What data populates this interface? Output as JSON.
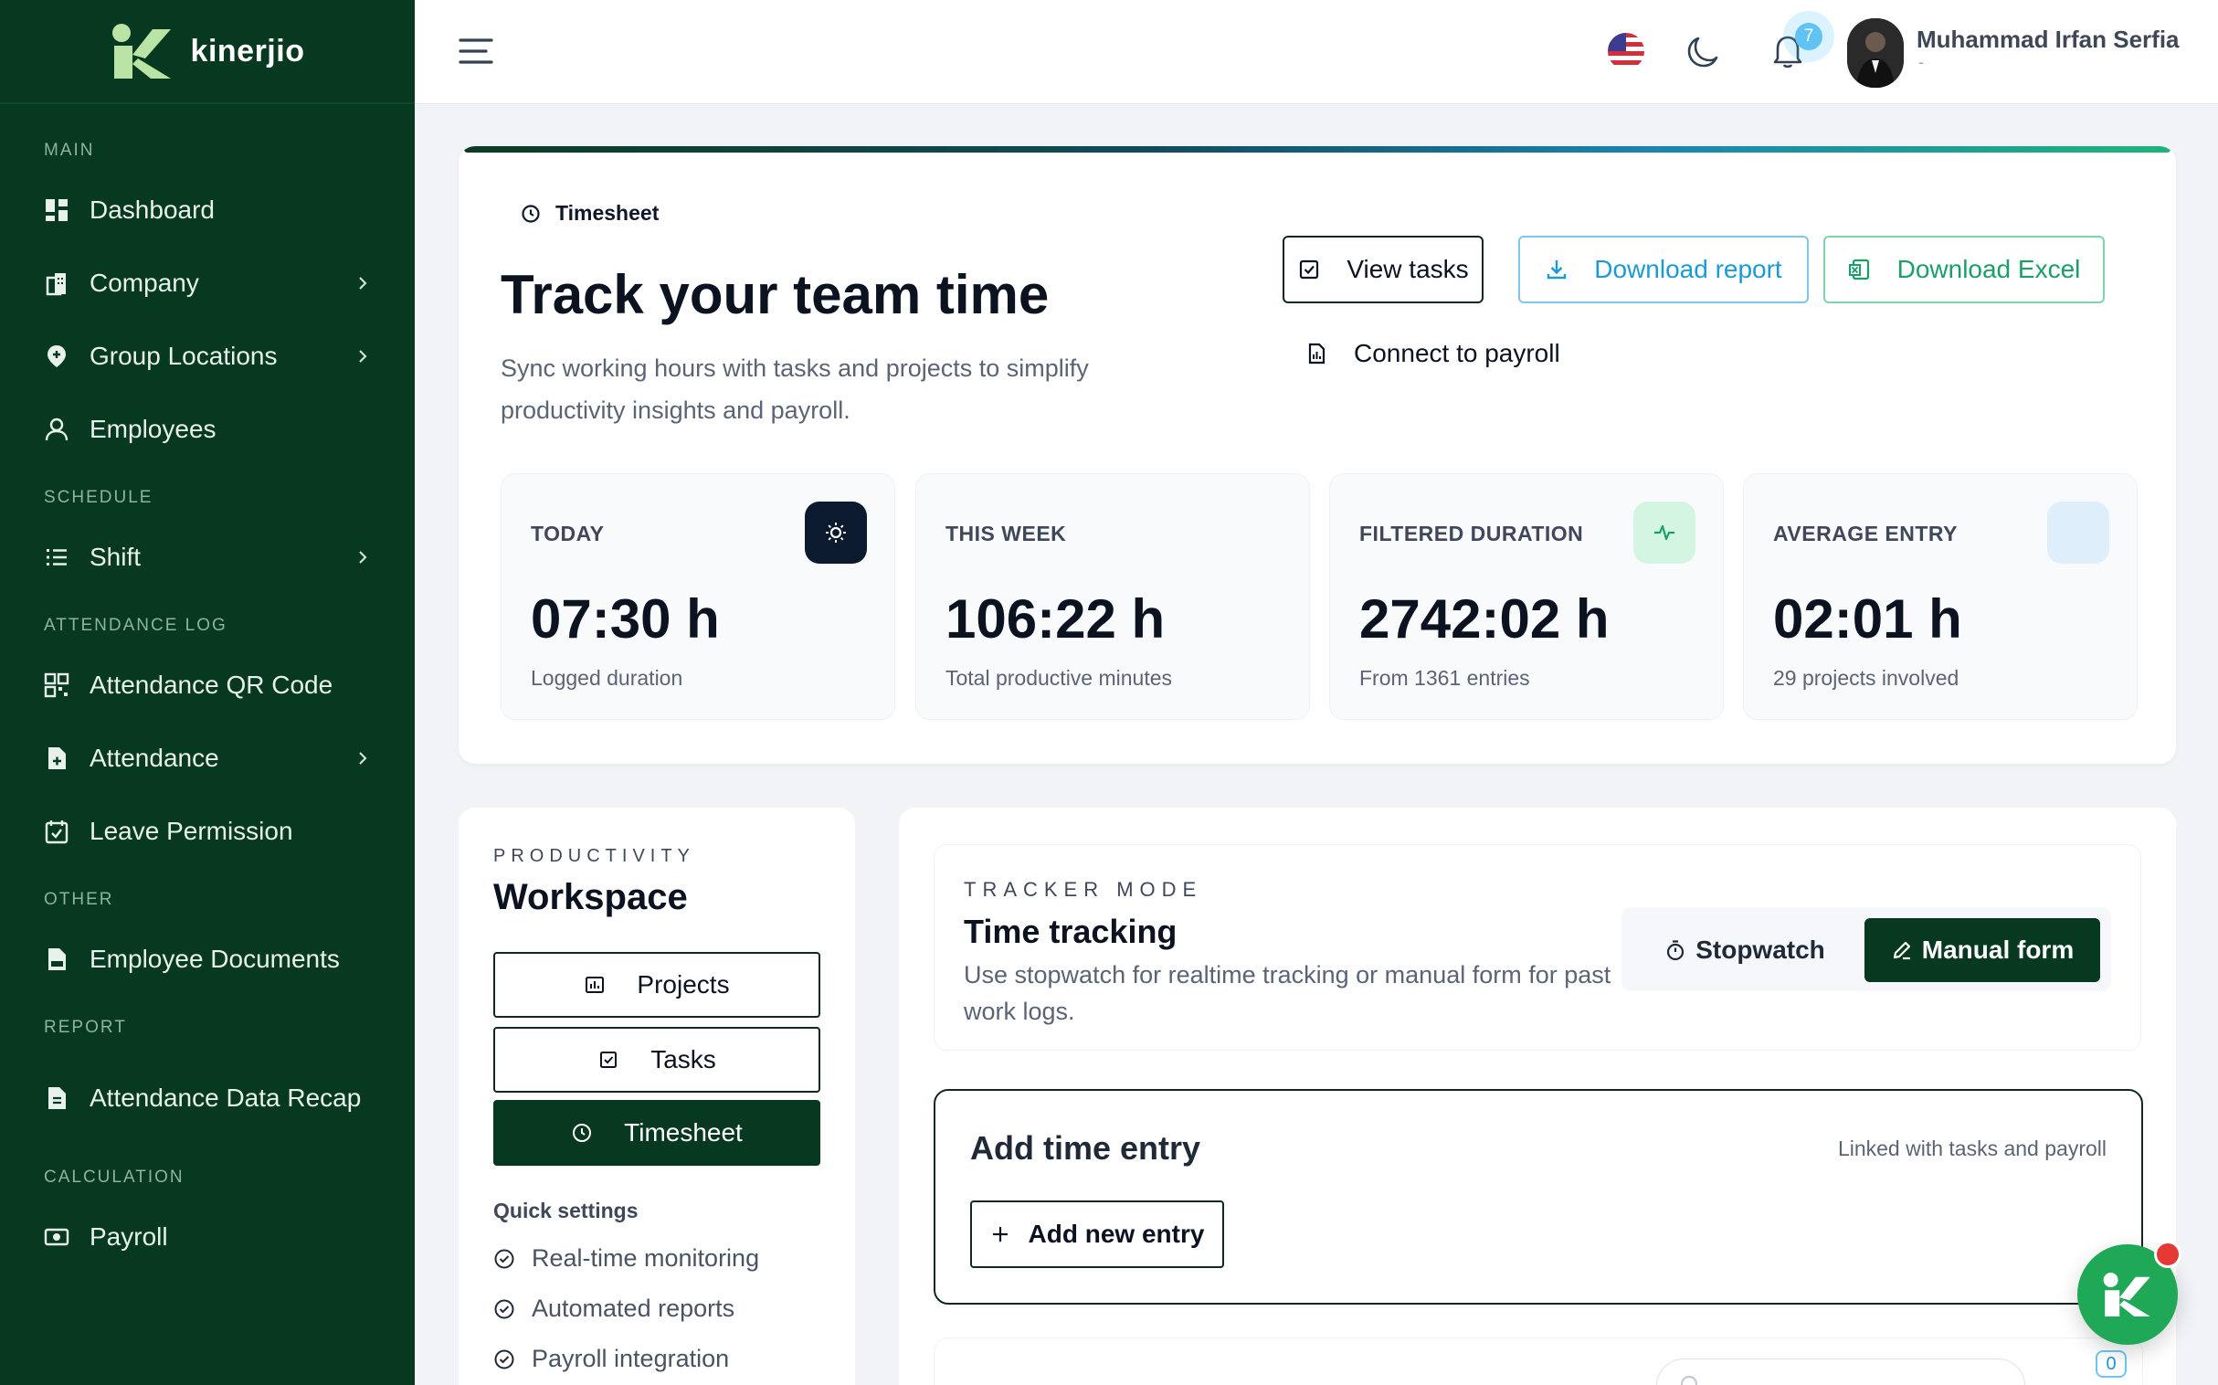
{
  "brand": {
    "name": "kinerjio"
  },
  "sidebar": {
    "sections": [
      {
        "title": "MAIN",
        "items": [
          {
            "label": "Dashboard",
            "icon": "dashboard-icon",
            "chevron": false
          },
          {
            "label": "Company",
            "icon": "building-icon",
            "chevron": true
          },
          {
            "label": "Group Locations",
            "icon": "location-pin-icon",
            "chevron": true
          },
          {
            "label": "Employees",
            "icon": "user-icon",
            "chevron": false
          }
        ]
      },
      {
        "title": "SCHEDULE",
        "items": [
          {
            "label": "Shift",
            "icon": "list-icon",
            "chevron": true
          }
        ]
      },
      {
        "title": "ATTENDANCE LOG",
        "items": [
          {
            "label": "Attendance QR Code",
            "icon": "qr-code-icon",
            "chevron": false
          },
          {
            "label": "Attendance",
            "icon": "file-plus-icon",
            "chevron": true
          },
          {
            "label": "Leave Permission",
            "icon": "calendar-check-icon",
            "chevron": false
          }
        ]
      },
      {
        "title": "OTHER",
        "items": [
          {
            "label": "Employee Documents",
            "icon": "document-icon",
            "chevron": false
          }
        ]
      },
      {
        "title": "REPORT",
        "items": [
          {
            "label": "Attendance Data Recap",
            "icon": "report-file-icon",
            "chevron": false
          }
        ]
      },
      {
        "title": "CALCULATION",
        "items": [
          {
            "label": "Payroll",
            "icon": "money-icon",
            "chevron": false
          }
        ]
      }
    ]
  },
  "topbar": {
    "notification_count": "7",
    "user_name": "Muhammad Irfan Serfia",
    "user_subtitle": "-"
  },
  "hero": {
    "breadcrumb": "Timesheet",
    "title": "Track your team time",
    "description": "Sync working hours with tasks and projects to simplify productivity insights and payroll.",
    "buttons": {
      "view_tasks": "View tasks",
      "download_report": "Download report",
      "download_excel": "Download Excel",
      "connect_payroll": "Connect to payroll"
    },
    "stats": [
      {
        "label": "TODAY",
        "value": "07:30 h",
        "sub": "Logged duration"
      },
      {
        "label": "THIS WEEK",
        "value": "106:22 h",
        "sub": "Total productive minutes"
      },
      {
        "label": "FILTERED DURATION",
        "value": "2742:02 h",
        "sub": "From 1361 entries"
      },
      {
        "label": "AVERAGE ENTRY",
        "value": "02:01 h",
        "sub": "29 projects involved"
      }
    ]
  },
  "workspace": {
    "kicker": "PRODUCTIVITY",
    "title": "Workspace",
    "buttons": {
      "projects": "Projects",
      "tasks": "Tasks",
      "timesheet": "Timesheet"
    },
    "quick_settings_title": "Quick settings",
    "quick_settings": [
      "Real-time monitoring",
      "Automated reports",
      "Payroll integration"
    ]
  },
  "tracker": {
    "kicker": "TRACKER MODE",
    "title": "Time tracking",
    "description": "Use stopwatch for realtime tracking or manual form for past work logs.",
    "modes": {
      "stopwatch": "Stopwatch",
      "manual": "Manual form"
    },
    "active_mode": "Manual form"
  },
  "entry": {
    "title": "Add time entry",
    "note": "Linked with tasks and payroll",
    "add_button": "Add new entry"
  },
  "corner_badge": "0",
  "colors": {
    "sidebar_bg": "#06391f",
    "accent_dark": "#06391f",
    "report_blue": "#1b9ad6",
    "excel_green": "#1aa066",
    "fab_green": "#1fa855"
  }
}
